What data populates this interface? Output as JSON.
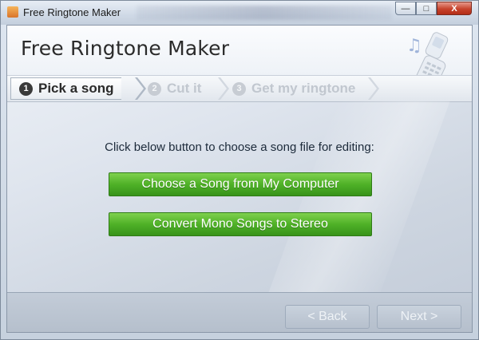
{
  "window": {
    "title": "Free Ringtone Maker",
    "icons": {
      "app": "app-icon",
      "minimize": "minimize-icon",
      "maximize": "maximize-icon",
      "close": "close-icon"
    },
    "caption": {
      "minimize_glyph": "—",
      "maximize_glyph": "□",
      "close_glyph": "X"
    }
  },
  "header": {
    "title": "Free Ringtone Maker",
    "art": "phone-music-icon"
  },
  "steps": [
    {
      "number": "1",
      "label": "Pick a song",
      "active": true
    },
    {
      "number": "2",
      "label": "Cut it",
      "active": false
    },
    {
      "number": "3",
      "label": "Get my ringtone",
      "active": false
    }
  ],
  "main": {
    "instruction": "Click below button to choose a song file for editing:",
    "choose_button": "Choose a Song from My Computer",
    "convert_button": "Convert Mono Songs to Stereo"
  },
  "footer": {
    "back_label": "< Back",
    "next_label": "Next >",
    "back_enabled": false,
    "next_enabled": false
  },
  "colors": {
    "accent_green": "#4fb127",
    "disabled_text": "#c1c7cf",
    "close_red": "#c7432c"
  }
}
